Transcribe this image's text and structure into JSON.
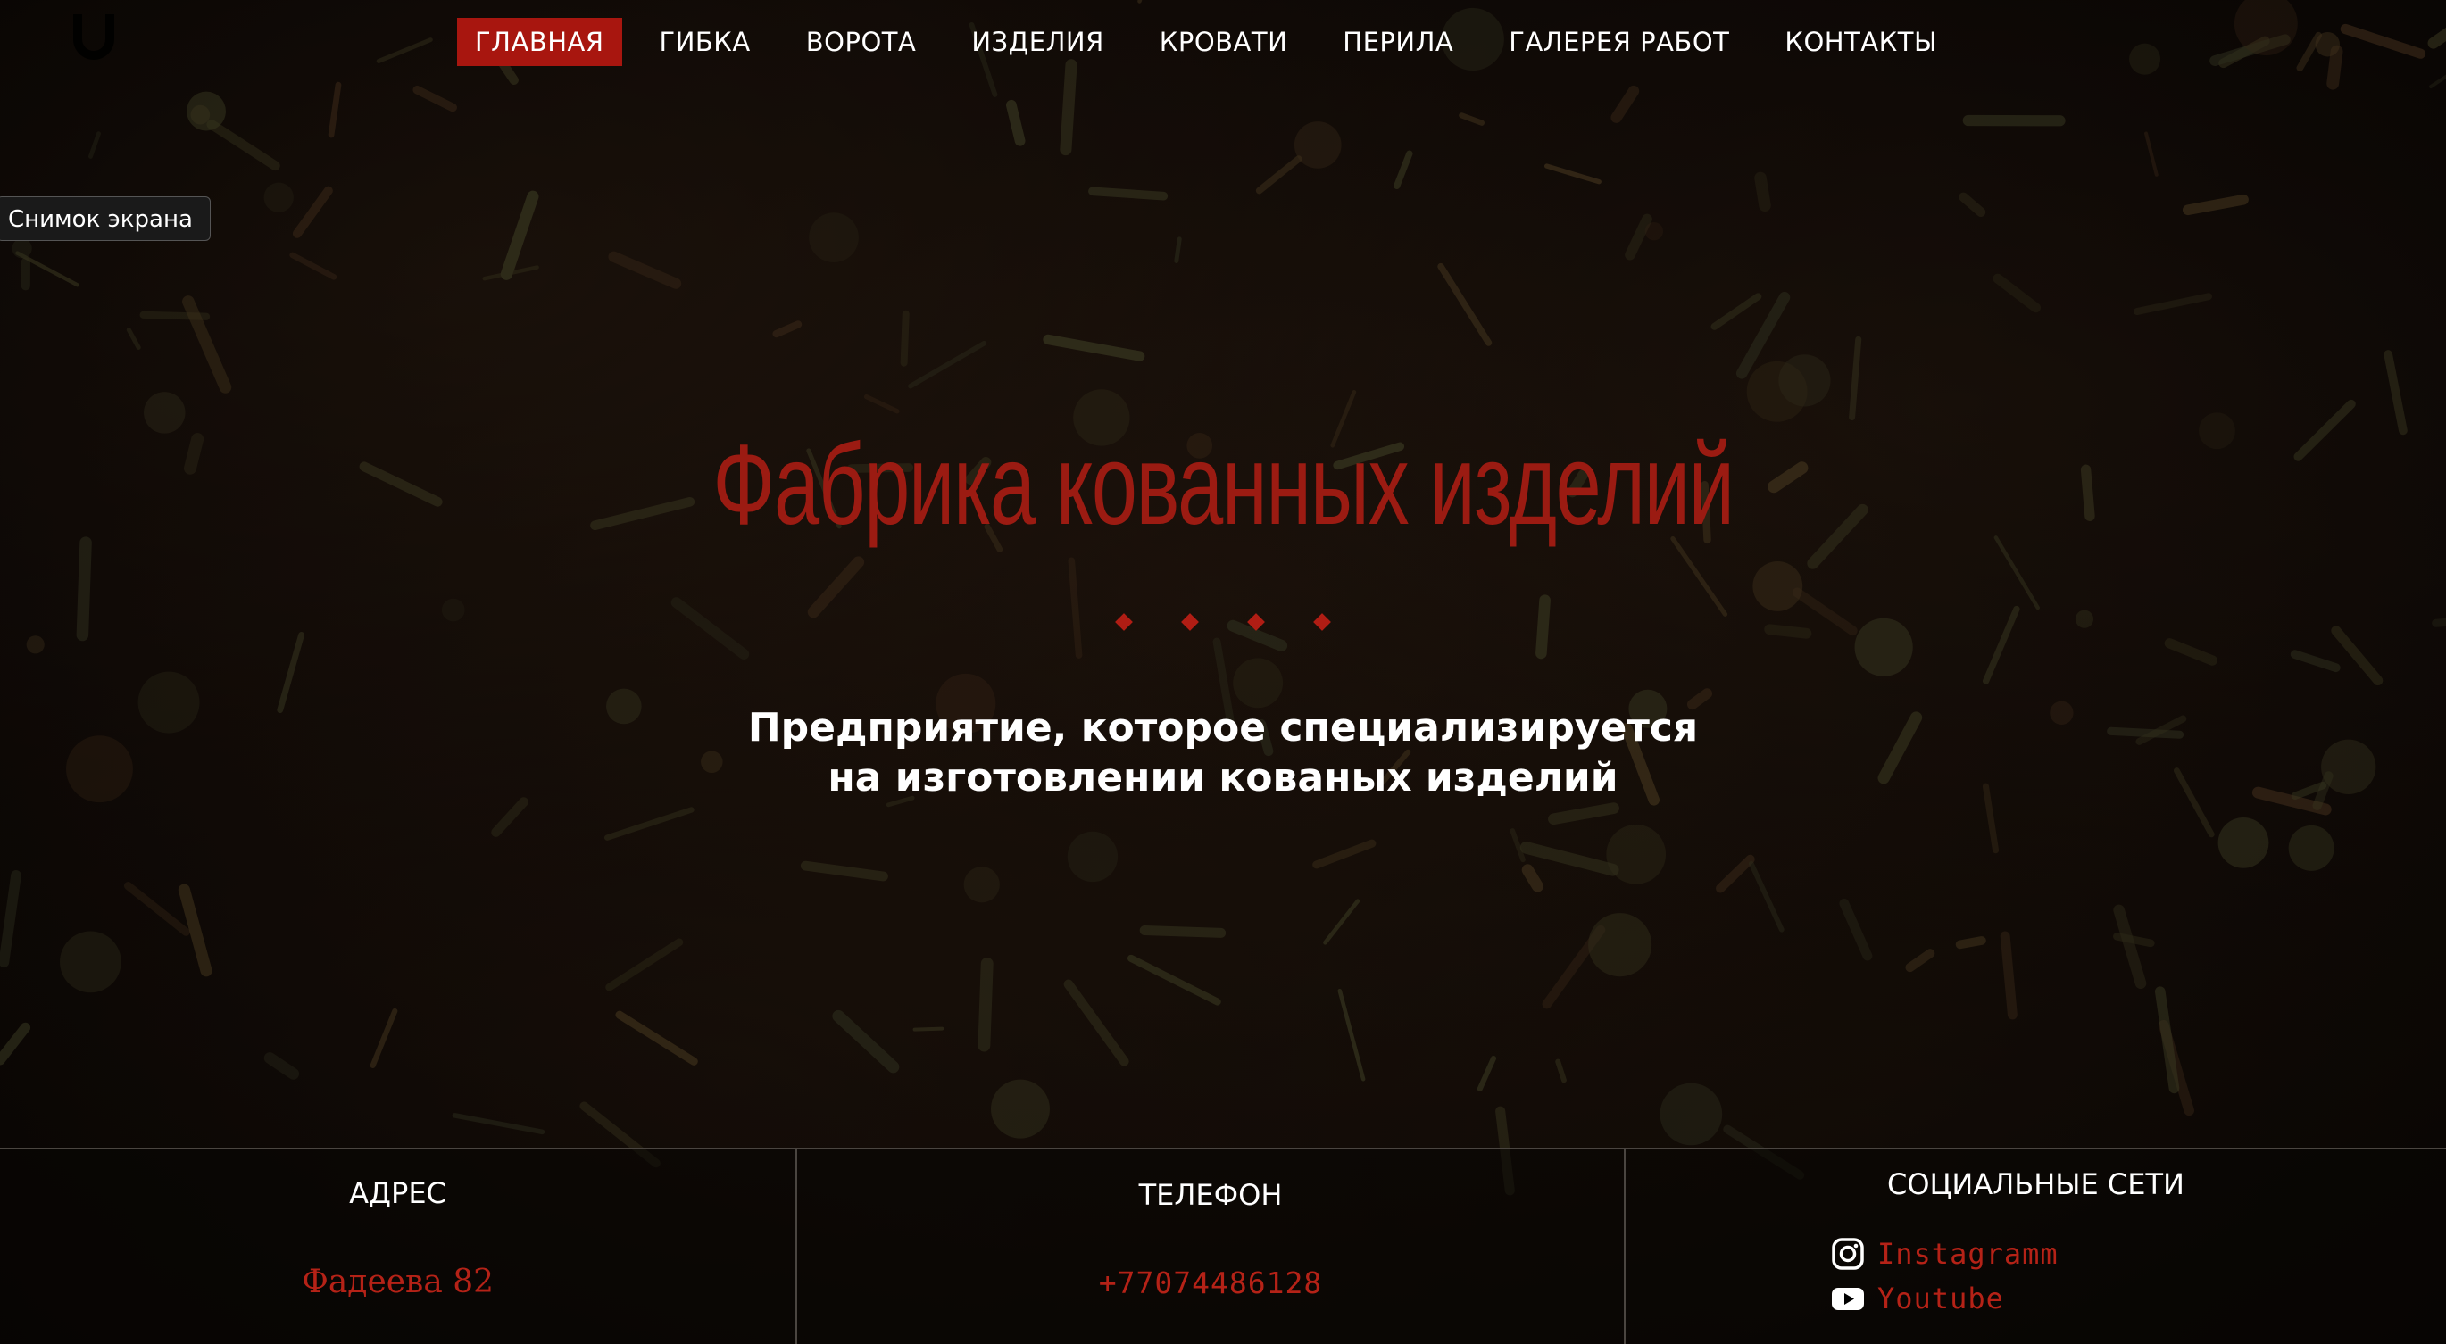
{
  "nav": {
    "items": [
      {
        "label": "ГЛАВНАЯ",
        "active": true
      },
      {
        "label": "ГИБКА",
        "active": false
      },
      {
        "label": "ВОРОТА",
        "active": false
      },
      {
        "label": "ИЗДЕЛИЯ",
        "active": false
      },
      {
        "label": "КРОВАТИ",
        "active": false
      },
      {
        "label": "ПЕРИЛА",
        "active": false
      },
      {
        "label": "ГАЛЕРЕЯ РАБОТ",
        "active": false
      },
      {
        "label": "КОНТАКТЫ",
        "active": false
      }
    ]
  },
  "tooltip": {
    "label": "Снимок экрана"
  },
  "hero": {
    "title": "Фабрика кованных изделий",
    "subtitle_line1": "Предприятие, которое специализируется",
    "subtitle_line2": "на изготовлении кованых изделий"
  },
  "footer": {
    "address": {
      "heading": "АДРЕС",
      "value": "Фадеева 82"
    },
    "phone": {
      "heading": "ТЕЛЕФОН",
      "value": "+77074486128"
    },
    "social": {
      "heading": "СОЦИАЛЬНЫЕ СЕТИ",
      "links": [
        {
          "label": "Instagramm",
          "icon": "instagram-icon"
        },
        {
          "label": "Youtube",
          "icon": "youtube-icon"
        }
      ]
    }
  },
  "colors": {
    "accent": "#a8160f",
    "accent_text": "#b52217",
    "title": "#9b1b12",
    "background": "#120b07"
  }
}
